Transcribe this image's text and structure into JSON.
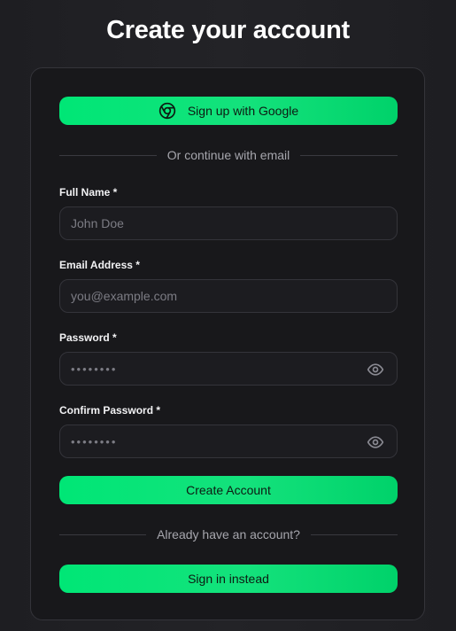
{
  "page": {
    "title": "Create your account"
  },
  "google_button": {
    "label": "Sign up with Google",
    "icon": "chrome-icon"
  },
  "divider_email": {
    "text": "Or continue with email"
  },
  "fields": {
    "full_name": {
      "label": "Full Name *",
      "placeholder": "John Doe",
      "value": ""
    },
    "email": {
      "label": "Email Address *",
      "placeholder": "you@example.com",
      "value": ""
    },
    "password": {
      "label": "Password *",
      "placeholder": "••••••••",
      "value": "",
      "toggle_icon": "eye-icon"
    },
    "confirm_password": {
      "label": "Confirm Password *",
      "placeholder": "••••••••",
      "value": "",
      "toggle_icon": "eye-icon"
    }
  },
  "create_button": {
    "label": "Create Account"
  },
  "divider_account": {
    "text": "Already have an account?"
  },
  "signin_button": {
    "label": "Sign in instead"
  },
  "colors": {
    "accent": "#00e676",
    "background": "#1e1e22",
    "card": "#18181b",
    "border": "#34343a"
  }
}
